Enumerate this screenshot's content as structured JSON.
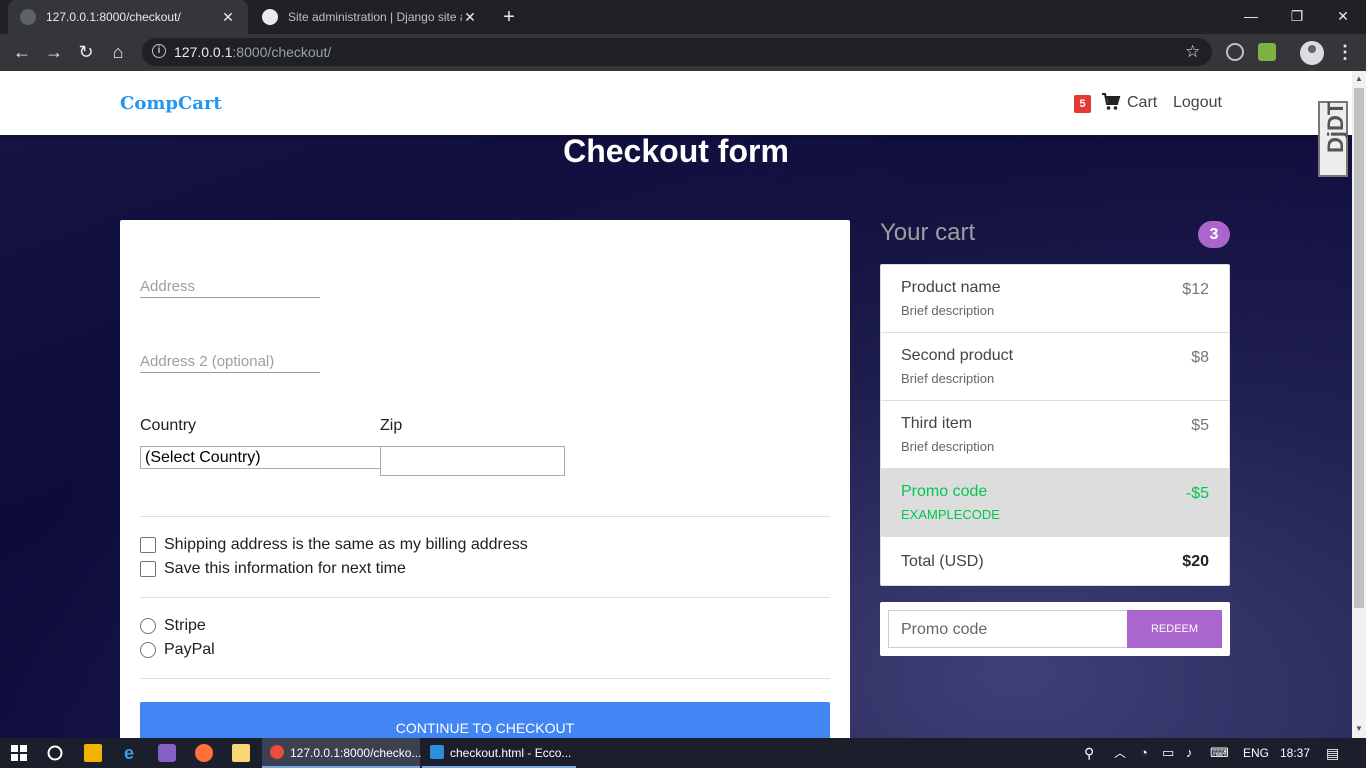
{
  "browser": {
    "tabs": [
      {
        "label": "127.0.0.1:8000/checkout/",
        "active": true
      },
      {
        "label": "Site administration | Django site admin",
        "active": false
      }
    ],
    "url_host": "127.0.0.1",
    "url_rest": ":8000/checkout/"
  },
  "site": {
    "brand": "CompCart",
    "cart_count": "5",
    "cart_label": "Cart",
    "logout_label": "Logout",
    "debug_toolbar": "DjDT"
  },
  "page": {
    "title": "Checkout form"
  },
  "form": {
    "address_placeholder": "Address",
    "address2_placeholder": "Address 2 (optional)",
    "country_label": "Country",
    "zip_label": "Zip",
    "country_value": "(Select Country)",
    "checkboxes": [
      "Shipping address is the same as my billing address",
      "Save this information for next time"
    ],
    "payment_options": [
      "Stripe",
      "PayPal"
    ],
    "continue_label": "CONTINUE TO CHECKOUT"
  },
  "cart": {
    "title": "Your cart",
    "count": "3",
    "items": [
      {
        "name": "Product name",
        "desc": "Brief description",
        "price": "$12"
      },
      {
        "name": "Second product",
        "desc": "Brief description",
        "price": "$8"
      },
      {
        "name": "Third item",
        "desc": "Brief description",
        "price": "$5"
      }
    ],
    "promo": {
      "name": "Promo code",
      "code": "EXAMPLECODE",
      "amount": "-$5"
    },
    "total_label": "Total (USD)",
    "total_value": "$20",
    "promo_placeholder": "Promo code",
    "redeem_label": "REDEEM"
  },
  "taskbar": {
    "apps": [
      {
        "label": "127.0.0.1:8000/checko..."
      },
      {
        "label": "checkout.html - Ecco..."
      }
    ],
    "lang": "ENG",
    "time": "18:37"
  },
  "colors": {
    "brand": "#2196f3",
    "primary_button": "#4285f4",
    "accent_purple": "#aa66cc",
    "promo_green": "#00c851",
    "badge_red": "#e53935"
  }
}
